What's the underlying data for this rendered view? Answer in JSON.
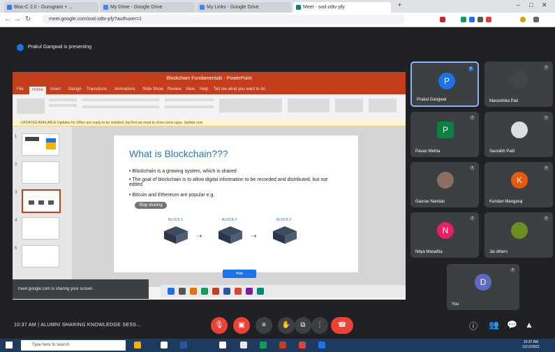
{
  "browser": {
    "tabs": [
      {
        "label": "Bloc-C 2.0 - Gurugram + ...",
        "active": false
      },
      {
        "label": "My Drive - Google Drive",
        "active": false
      },
      {
        "label": "My Links - Google Drive",
        "active": false
      },
      {
        "label": "Meet - sod-zdtv-pfy",
        "active": true
      }
    ],
    "url": "meet.google.com/sod-zdtv-pfy?authuser=1"
  },
  "presenting": {
    "label": "Prakul Gangwal is presenting"
  },
  "powerpoint": {
    "title": "Blockchain Fundamentals - PowerPoint",
    "ribbon_tabs": [
      "File",
      "Home",
      "Insert",
      "Design",
      "Transitions",
      "Animations",
      "Slide Show",
      "Review",
      "View",
      "Help",
      "Tell me what you want to do"
    ],
    "notice": "UPDATES AVAILABLE  Updates for Office are ready to be installed, but first we need to close some apps.  Update now",
    "slide_title": "What is Blockchain???",
    "bullets": [
      "Blockchain is a growing system, which is shared",
      "The goal of blockchain is to allow digital information to be recorded and distributed, but not edited",
      "Bitcoin and Ethereum are popular e.g."
    ],
    "blocks": [
      "BLOCK 1",
      "BLOCK 2",
      "BLOCK 3"
    ],
    "thumb_numbers": [
      "1",
      "2",
      "3",
      "4",
      "5"
    ],
    "overlay_pill": "Stop sharing",
    "share_button": "Hide",
    "sharing_message": "meet.google.com is sharing your screen."
  },
  "participants": [
    {
      "name": "Prakul Gangwal",
      "initial": "P",
      "color": "#1a73e8",
      "type": "initial",
      "active": true
    },
    {
      "name": "Manoshika Pati",
      "initial": "",
      "color": "#555",
      "type": "photo"
    },
    {
      "name": "Pavan Mehta",
      "initial": "P",
      "color": "#0b8043",
      "type": "initial"
    },
    {
      "name": "Saurabh Patil",
      "initial": "",
      "color": "#777",
      "type": "photo"
    },
    {
      "name": "Gaurav Nandan",
      "initial": "",
      "color": "#888",
      "type": "photo"
    },
    {
      "name": "Kundan Mangaraj",
      "initial": "K",
      "color": "#e8590c",
      "type": "initial"
    },
    {
      "name": "Nitya Maradita",
      "initial": "N",
      "color": "#e91e63",
      "type": "initial"
    },
    {
      "name": "Jai others",
      "initial": "",
      "color": "#6b8e23",
      "type": "photo"
    },
    {
      "name": "You",
      "initial": "D",
      "color": "#5c6bc0",
      "type": "initial"
    }
  ],
  "meeting": {
    "info": "10:37 AM  |  ALUMNI SHARING KNOWLEDGE SESS..."
  },
  "controls": [
    "mic",
    "camera",
    "captions",
    "raise-hand",
    "present",
    "more"
  ],
  "taskbar": {
    "search_placeholder": "Type here to search",
    "time": "10:37 AM",
    "date": "12/12/2021"
  }
}
